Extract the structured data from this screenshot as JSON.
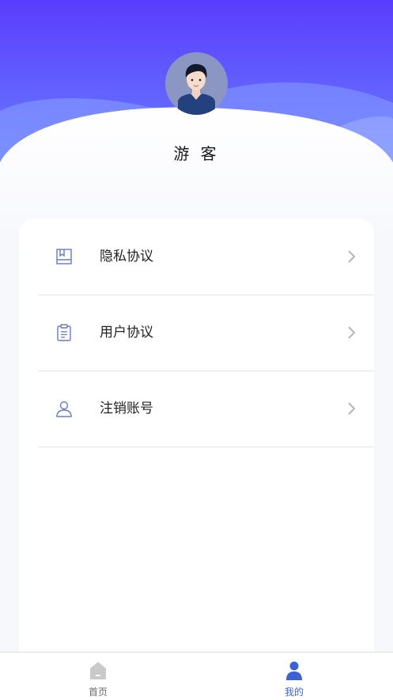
{
  "profile": {
    "avatar_icon": "user-avatar-illustration",
    "username": "游 客"
  },
  "menu": [
    {
      "icon": "book-icon",
      "label": "隐私协议"
    },
    {
      "icon": "clipboard-icon",
      "label": "用户协议"
    },
    {
      "icon": "user-icon",
      "label": "注销账号"
    }
  ],
  "tabbar": {
    "home_label": "首页",
    "mine_label": "我的",
    "active_tab": "mine"
  },
  "colors": {
    "header_gradient_top": "#5a3dfd",
    "header_gradient_bottom": "#6f9aff",
    "accent": "#3a62d6",
    "icon_outline": "#6779c9",
    "inactive_tab": "#c9c9c9"
  }
}
